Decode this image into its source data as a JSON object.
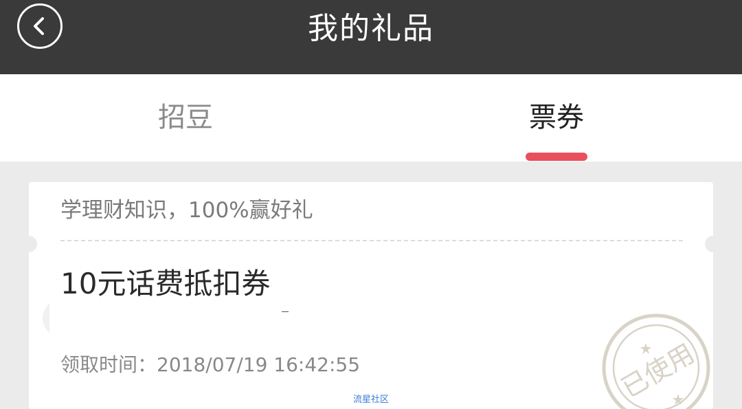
{
  "header": {
    "title": "我的礼品",
    "back_icon": "chevron-left-icon"
  },
  "tabs": [
    {
      "label": "招豆",
      "active": false
    },
    {
      "label": "票券",
      "active": true
    }
  ],
  "colors": {
    "header_bg": "#3a3a3a",
    "accent": "#e9505d",
    "page_bg": "#ebebeb"
  },
  "coupon": {
    "subtitle": "学理财知识，100%赢好礼",
    "title": "10元话费抵扣券",
    "claim_time": "领取时间：2018/07/19 16:42:55",
    "stamp_text": "已使用"
  },
  "watermark": "流星社区"
}
